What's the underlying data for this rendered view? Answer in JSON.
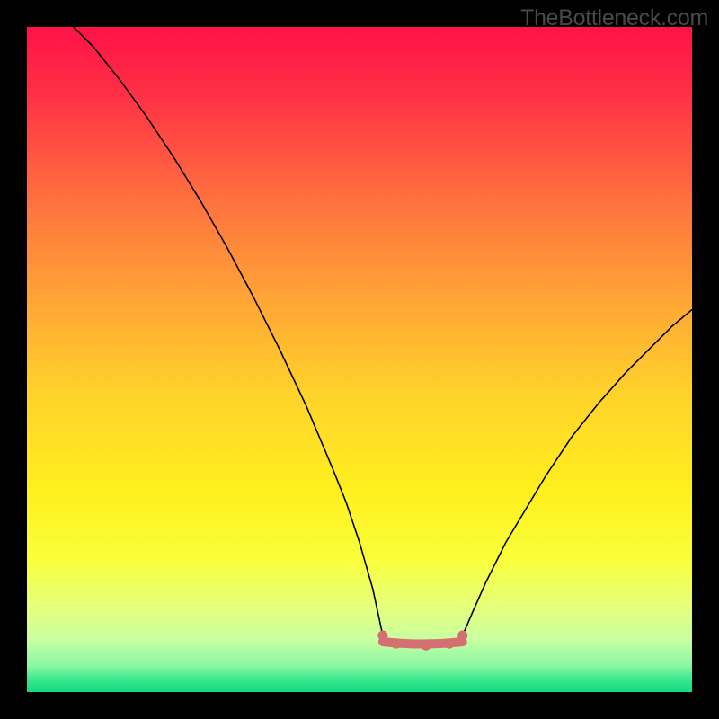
{
  "watermark": "TheBottleneck.com",
  "chart_data": {
    "type": "line",
    "title": "",
    "xlabel": "",
    "ylabel": "",
    "xlim": [
      0,
      100
    ],
    "ylim": [
      0,
      100
    ],
    "series": [
      {
        "name": "left-curve",
        "x": [
          7,
          10,
          14,
          18,
          22,
          26,
          30,
          34,
          38,
          42,
          46,
          48,
          50,
          52,
          53.5
        ],
        "y": [
          100,
          97,
          92,
          86.5,
          80.5,
          74,
          67,
          59.5,
          51.5,
          43,
          33.5,
          28.5,
          22.5,
          15.5,
          8.5
        ]
      },
      {
        "name": "right-curve",
        "x": [
          65.5,
          67,
          69,
          72,
          75,
          78,
          82,
          86,
          90,
          94,
          97,
          100
        ],
        "y": [
          8.5,
          12,
          16.5,
          22.5,
          27.5,
          32.5,
          38.5,
          43.5,
          48,
          52,
          55,
          57.5
        ]
      }
    ],
    "valley_band": {
      "x_start": 53.5,
      "x_end": 65.5,
      "y": 7.3
    },
    "valley_markers": [
      {
        "x": 53.5,
        "y": 8.5
      },
      {
        "x": 55.5,
        "y": 7.3
      },
      {
        "x": 60.0,
        "y": 7.0
      },
      {
        "x": 63.5,
        "y": 7.3
      },
      {
        "x": 65.5,
        "y": 8.5
      }
    ],
    "gradient_stops": [
      {
        "offset": 0.0,
        "color": "#ff1248"
      },
      {
        "offset": 0.1,
        "color": "#ff2f46"
      },
      {
        "offset": 0.25,
        "color": "#ff6d3f"
      },
      {
        "offset": 0.4,
        "color": "#ffa236"
      },
      {
        "offset": 0.55,
        "color": "#ffd22a"
      },
      {
        "offset": 0.7,
        "color": "#fff01e"
      },
      {
        "offset": 0.8,
        "color": "#f9ff3a"
      },
      {
        "offset": 0.87,
        "color": "#e7ff7a"
      },
      {
        "offset": 0.92,
        "color": "#c9ffa0"
      },
      {
        "offset": 0.96,
        "color": "#8bf7a5"
      },
      {
        "offset": 0.985,
        "color": "#2fe58c"
      },
      {
        "offset": 1.0,
        "color": "#18d97f"
      }
    ]
  }
}
